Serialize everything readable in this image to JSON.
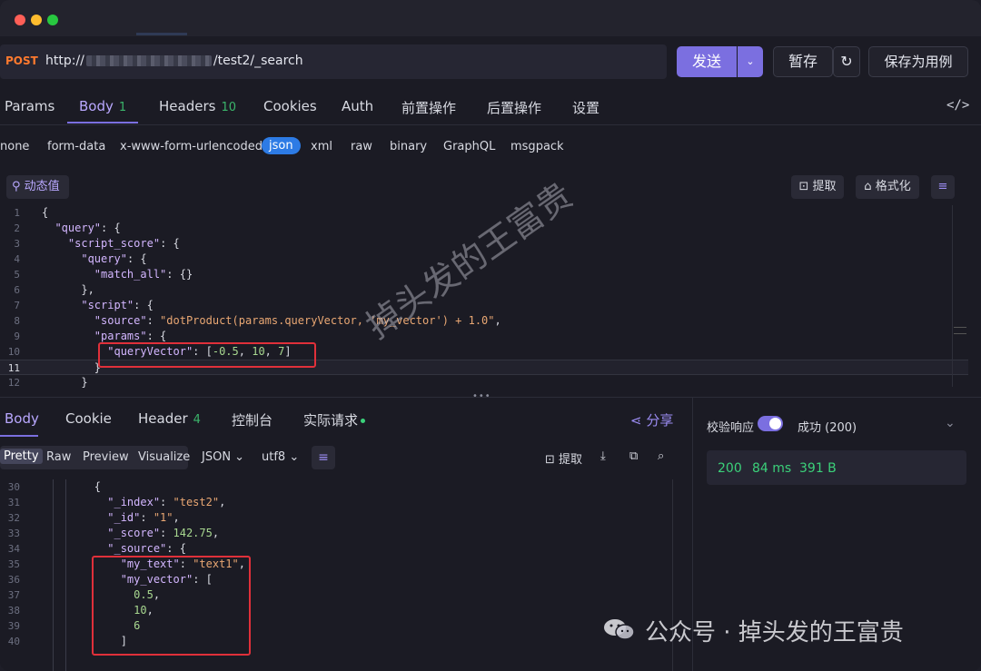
{
  "request": {
    "method": "POST",
    "url_prefix": "http://",
    "url_suffix": "/test2/_search",
    "send_label": "发送",
    "save_label": "暂存",
    "save_case_label": "保存为用例"
  },
  "request_tabs": [
    {
      "label": "Params"
    },
    {
      "label": "Body",
      "badge": "1"
    },
    {
      "label": "Headers",
      "badge": "10"
    },
    {
      "label": "Cookies"
    },
    {
      "label": "Auth"
    },
    {
      "label": "前置操作"
    },
    {
      "label": "后置操作"
    },
    {
      "label": "设置"
    }
  ],
  "body_types": [
    "none",
    "form-data",
    "x-www-form-urlencoded",
    "json",
    "xml",
    "raw",
    "binary",
    "GraphQL",
    "msgpack"
  ],
  "toolbar": {
    "dynamic_value": "动态值",
    "extract": "提取",
    "format": "格式化"
  },
  "request_code": [
    {
      "n": "1",
      "t": "{"
    },
    {
      "n": "2",
      "t": "  \"query\": {"
    },
    {
      "n": "3",
      "t": "    \"script_score\": {"
    },
    {
      "n": "4",
      "t": "      \"query\": {"
    },
    {
      "n": "5",
      "t": "        \"match_all\": {}"
    },
    {
      "n": "6",
      "t": "      },"
    },
    {
      "n": "7",
      "t": "      \"script\": {"
    },
    {
      "n": "8",
      "t": "        \"source\": \"dotProduct(params.queryVector, 'my_vector') + 1.0\","
    },
    {
      "n": "9",
      "t": "        \"params\": {"
    },
    {
      "n": "10",
      "t": "          \"queryVector\": [-0.5, 10, 7]"
    },
    {
      "n": "11",
      "t": "        }"
    },
    {
      "n": "12",
      "t": "      }"
    }
  ],
  "response_tabs": [
    {
      "label": "Body"
    },
    {
      "label": "Cookie"
    },
    {
      "label": "Header",
      "badge": "4"
    },
    {
      "label": "控制台"
    },
    {
      "label": "实际请求"
    }
  ],
  "share_label": "分享",
  "view_modes": [
    "Pretty",
    "Raw",
    "Preview",
    "Visualize"
  ],
  "format_select": "JSON",
  "encoding_select": "utf8",
  "response_extract": "提取",
  "response_code": [
    {
      "n": "30",
      "t": "        {"
    },
    {
      "n": "31",
      "t": "          \"_index\": \"test2\","
    },
    {
      "n": "32",
      "t": "          \"_id\": \"1\","
    },
    {
      "n": "33",
      "t": "          \"_score\": 142.75,"
    },
    {
      "n": "34",
      "t": "          \"_source\": {"
    },
    {
      "n": "35",
      "t": "            \"my_text\": \"text1\","
    },
    {
      "n": "36",
      "t": "            \"my_vector\": ["
    },
    {
      "n": "37",
      "t": "              0.5,"
    },
    {
      "n": "38",
      "t": "              10,"
    },
    {
      "n": "39",
      "t": "              6"
    },
    {
      "n": "40",
      "t": "            ]"
    }
  ],
  "status_panel": {
    "verify_label": "校验响应",
    "result": "成功 (200)",
    "code": "200",
    "time": "84 ms",
    "size": "391 B"
  },
  "watermark": "掉头发的王富贵",
  "footer_watermark": "公众号 · 掉头发的王富贵",
  "colors": {
    "accent": "#7b6fe0",
    "method": "#ff7a2e",
    "success": "#3bd17a",
    "highlight_box": "#e0303a"
  }
}
